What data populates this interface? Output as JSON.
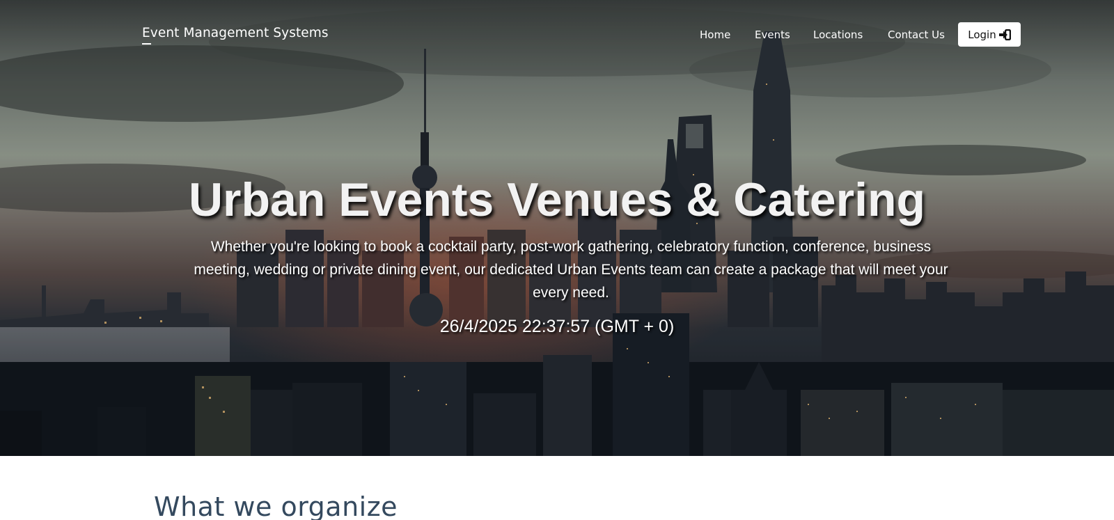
{
  "navbar": {
    "brand": "Event Management Systems",
    "links": [
      "Home",
      "Events",
      "Locations",
      "Contact Us"
    ],
    "login_label": "Login",
    "login_icon": "sign-in-icon"
  },
  "hero": {
    "title": "Urban Events Venues & Catering",
    "description": "Whether you're looking to book a cocktail party, post-work gathering, celebratory function, conference, business meeting, wedding or private dining event, our dedicated Urban Events team can create a package that will meet your every need.",
    "clock": "26/4/2025 22:37:57 (GMT + 0)",
    "background": "city-skyline-at-dusk"
  },
  "section": {
    "title": "What we organize"
  },
  "colors": {
    "section_title": "#34495e",
    "login_bg": "#ffffff",
    "nav_text": "#ffffff"
  }
}
